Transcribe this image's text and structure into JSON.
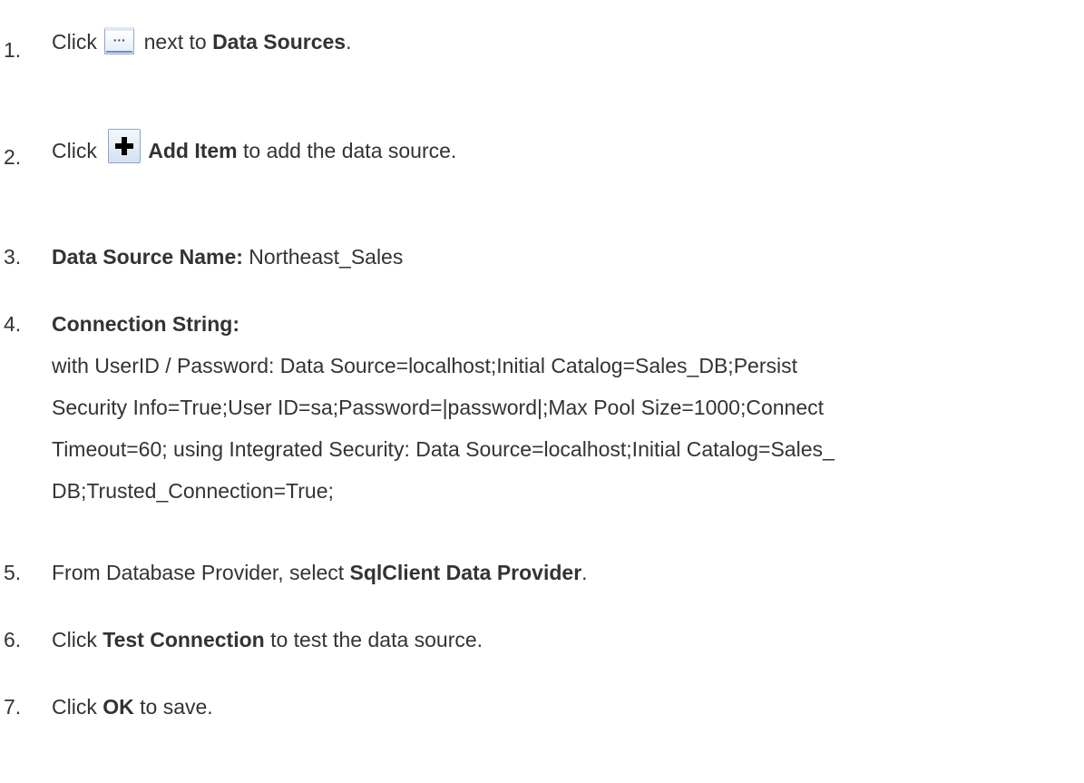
{
  "steps": [
    {
      "num": "1.",
      "pre": "Click",
      "icon": "ellipsis-button-icon",
      "mid": " next to ",
      "bold": "Data Sources",
      "post": "."
    },
    {
      "num": "2.",
      "pre": "Click",
      "icon": "add-item-plus-icon",
      "bold": "Add Item",
      "post": " to add the data source."
    },
    {
      "num": "3.",
      "bold": "Data Source Name:",
      "post": " Northeast_Sales"
    },
    {
      "num": "4.",
      "bold": "Connection String:",
      "lines": [
        "with UserID / Password: Data Source=localhost;Initial Catalog=Sales_DB;Persist",
        "Security Info=True;User ID=sa;Password=|password|;Max Pool Size=1000;Connect",
        "Timeout=60; using Integrated Security: Data Source=localhost;Initial Catalog=Sales_",
        "DB;Trusted_Connection=True;"
      ]
    },
    {
      "num": "5.",
      "pre": "From Database Provider, select ",
      "bold": "SqlClient Data Provider",
      "post": "."
    },
    {
      "num": "6.",
      "pre": "Click ",
      "bold": "Test Connection",
      "post": " to test the data source."
    },
    {
      "num": "7.",
      "pre": "Click ",
      "bold": "OK",
      "post": " to save."
    }
  ]
}
